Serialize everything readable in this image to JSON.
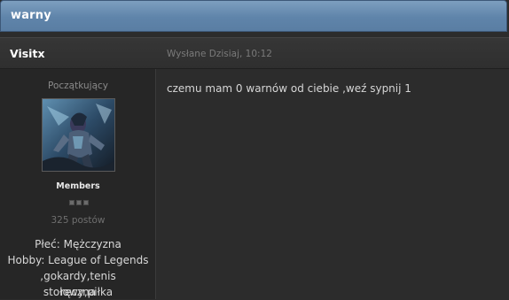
{
  "topic": {
    "title": "warny"
  },
  "post": {
    "author_name": "Visitx",
    "date": "Wysłane Dzisiaj, 10:12",
    "message": "czemu mam 0 warnów od ciebie ,weź sypnij 1"
  },
  "author": {
    "rank": "Początkujący",
    "group": "Members",
    "post_count": "325 postów",
    "gender": "Płeć: Mężczyzna",
    "hobby_line1": "Hobby: League of Legends",
    "hobby_line2": ",gokardy,tenis stołowy,piłka",
    "hobby_line3": "ręczna"
  },
  "colors": {
    "topic_bar": "#5f84aa",
    "background": "#2c2c2c",
    "author_panel": "#262626"
  }
}
